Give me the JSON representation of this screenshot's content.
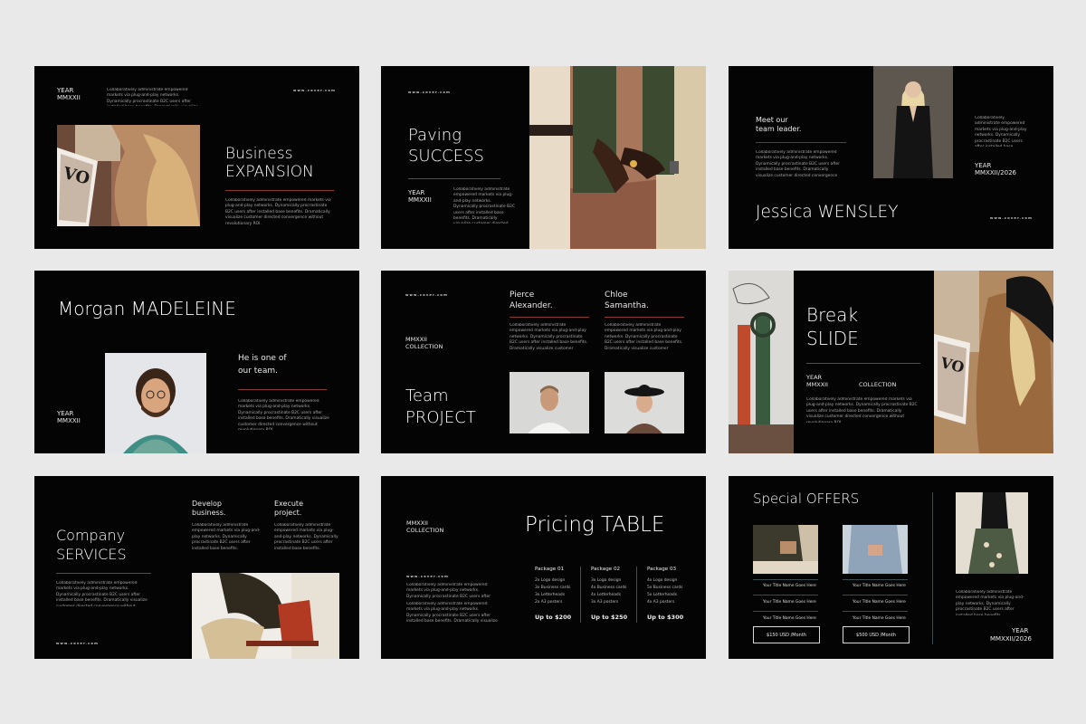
{
  "url_mark": "www.cover.com",
  "body_text": "Collaboratively administrate empowered markets via plug-and-play networks. Dynamically procrastinate B2C users after installed base benefits. Dramatically visualize customer directed convergence without revolutionary ROI.",
  "s1": {
    "year": "YEAR",
    "year_code": "MMXXII",
    "title_line1": "Business",
    "title_line2": "EXPANSION"
  },
  "s2": {
    "title_line1": "Paving",
    "title_line2": "SUCCESS",
    "year": "YEAR",
    "year_code": "MMXXII"
  },
  "s3": {
    "meet_line1": "Meet our",
    "meet_line2": "team leader.",
    "year": "YEAR",
    "year_range": "MMXXII/2026",
    "name": "Jessica WENSLEY"
  },
  "s4": {
    "name": "Morgan MADELEINE",
    "tag_line1": "He is one of",
    "tag_line2": "our team.",
    "year": "YEAR",
    "year_code": "MMXXII"
  },
  "s5": {
    "collection_line1": "MMXXII",
    "collection_line2": "COLLECTION",
    "member1_line1": "Pierce",
    "member1_line2": "Alexander.",
    "member2_line1": "Chloe",
    "member2_line2": "Samantha.",
    "title_line1": "Team",
    "title_line2": "PROJECT"
  },
  "s6": {
    "title_line1": "Break",
    "title_line2": "SLIDE",
    "year": "YEAR",
    "year_code": "MMXXII",
    "collection": "COLLECTION"
  },
  "s7": {
    "title_line1": "Company",
    "title_line2": "SERVICES",
    "col1_line1": "Develop",
    "col1_line2": "business.",
    "col2_line1": "Execute",
    "col2_line2": "project."
  },
  "s8": {
    "collection_line1": "MMXXII",
    "collection_line2": "COLLECTION",
    "title": "Pricing TABLE",
    "packages": [
      {
        "name": "Package 01",
        "items": [
          "2x Logo design",
          "3x Business cards",
          "3x Letterheads",
          "2x A3 posters"
        ],
        "price": "Up to $200"
      },
      {
        "name": "Package 02",
        "items": [
          "3x Logo design",
          "4x Business cards",
          "4x Letterheads",
          "3x A3 posters"
        ],
        "price": "Up to $250"
      },
      {
        "name": "Package 03",
        "items": [
          "4x Logo design",
          "5x Business cards",
          "5x Letterheads",
          "4x A3 posters"
        ],
        "price": "Up to $300"
      }
    ]
  },
  "s9": {
    "title": "Special OFFERS",
    "offer1": {
      "line": "Your Title Name Goes Here",
      "price": "$150 USD /Month"
    },
    "offer2": {
      "line": "Your Title Name Goes Here",
      "price": "$500 USD /Month"
    },
    "year": "YEAR",
    "year_range": "MMXXII/2026"
  },
  "colors": {
    "background": "#e9e9e9",
    "slide": "#040404",
    "accent_rule": "#8a3a28",
    "muted_rule": "#3b4b4e"
  },
  "icons": [
    "magazine-photo",
    "handshake-photo",
    "portrait-photo"
  ]
}
